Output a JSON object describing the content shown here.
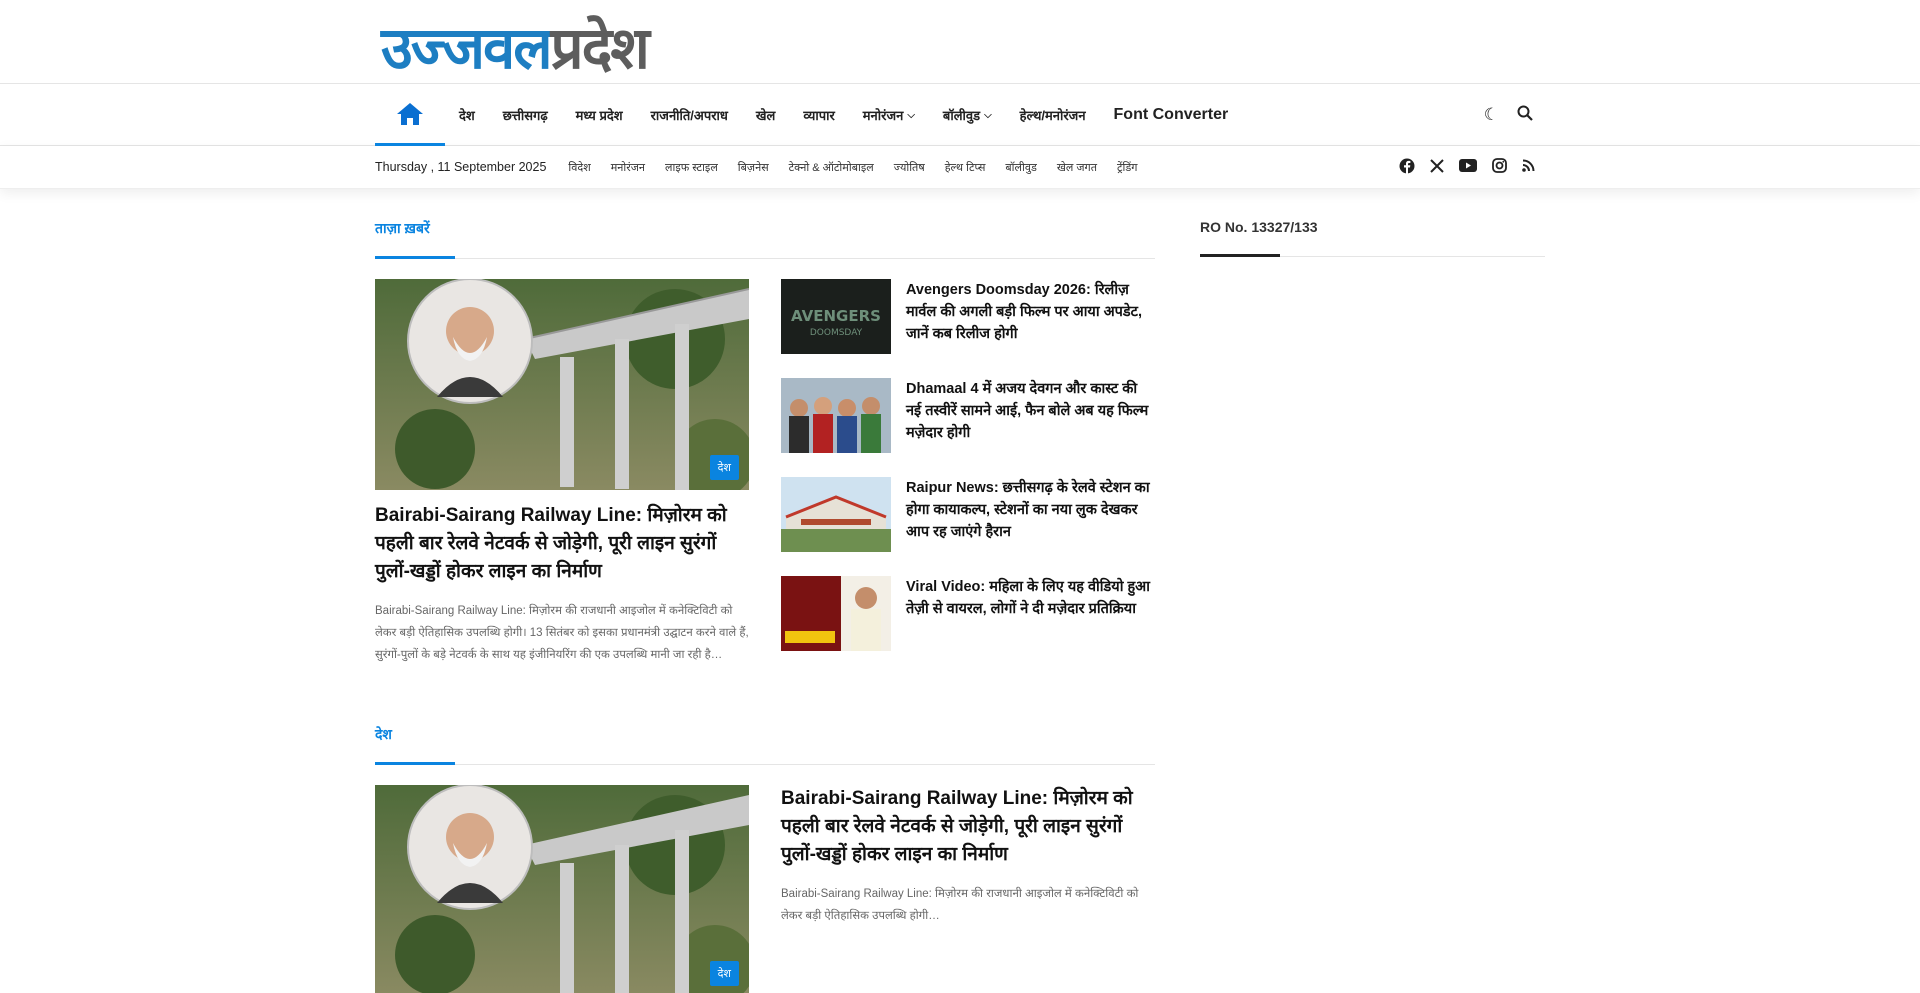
{
  "logo": {
    "part1": "उज्जवल",
    "part2": "प्रदेश"
  },
  "main_nav": {
    "items": [
      {
        "label": "देश"
      },
      {
        "label": "छत्तीसगढ़"
      },
      {
        "label": "मध्य प्रदेश"
      },
      {
        "label": "राजनीति/अपराध"
      },
      {
        "label": "खेल"
      },
      {
        "label": "व्यापार"
      },
      {
        "label": "मनोरंजन",
        "dropdown": true
      },
      {
        "label": "बॉलीवुड",
        "dropdown": true
      },
      {
        "label": "हेल्थ/मनोरंजन"
      }
    ],
    "font_converter": "Font Converter"
  },
  "sub_bar": {
    "date": "Thursday , 11 September 2025",
    "items": [
      "विदेश",
      "मनोरंजन",
      "लाइफ स्टाइल",
      "बिज़नेस",
      "टेक्नो & ऑटोमोबाइल",
      "ज्योतिष",
      "हेल्थ टिप्स",
      "बॉलीवुड",
      "खेल जगत",
      "ट्रेंडिंग"
    ]
  },
  "sections": {
    "first": {
      "title": "ताज़ा ख़बरें",
      "big_post": {
        "category": "देश",
        "title": "Bairabi-Sairang Railway Line: मिज़ोरम को पहली बार रेलवे नेटवर्क से जोड़ेगी, पूरी लाइन सुरंगों पुलों-खड्डों होकर लाइन का निर्माण",
        "excerpt": "Bairabi-Sairang Railway Line: मिज़ोरम की राजधानी आइजोल में कनेक्टिविटी को लेकर बड़ी ऐतिहासिक उपलब्धि होगी। 13 सितंबर को इसका प्रधानमंत्री उद्घाटन करने वाले हैं, सुरंगों-पुलों के बड़े नेटवर्क के साथ यह इंजीनियरिंग की एक उपलब्धि मानी जा रही है…"
      },
      "list": [
        {
          "title": "Avengers Doomsday 2026: रिलीज़ मार्वल की अगली बड़ी फिल्म पर आया अपडेट, जानें कब रिलीज होगी"
        },
        {
          "title": "Dhamaal 4 में अजय देवगन और कास्ट की नई तस्वीरें सामने आई, फैन बोले अब यह फिल्म मज़ेदार होगी"
        },
        {
          "title": "Raipur News: छत्तीसगढ़ के रेलवे स्टेशन का होगा कायाकल्प, स्टेशनों का नया लुक देखकर आप रह जाएंगे हैरान"
        },
        {
          "title": "Viral Video: महिला के लिए यह वीडियो हुआ तेज़ी से वायरल, लोगों ने दी मज़ेदार प्रतिक्रिया"
        }
      ]
    },
    "second": {
      "title": "देश",
      "big_post": {
        "category": "देश"
      },
      "right_post": {
        "title": "Bairabi-Sairang Railway Line: मिज़ोरम को पहली बार रेलवे नेटवर्क से जोड़ेगी, पूरी लाइन सुरंगों पुलों-खड्डों होकर लाइन का निर्माण",
        "excerpt": "Bairabi-Sairang Railway Line: मिज़ोरम की राजधानी आइजोल में कनेक्टिविटी को लेकर बड़ी ऐतिहासिक उपलब्धि होगी…"
      }
    }
  },
  "sidebar": {
    "title": "RO No. 13327/133"
  }
}
